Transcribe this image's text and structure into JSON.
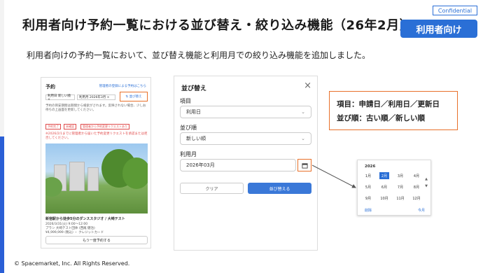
{
  "slide": {
    "title": "利用者向け予約一覧における並び替え・絞り込み機能（26年2月）",
    "confidential_label": "Confidential",
    "badge_label": "利用者向け",
    "subtitle": "利用者向けの予約一覧において、並び替え機能と利用月での絞り込み機能を追加しました。",
    "footer": "© Spacemarket, Inc. All Rights Reserved."
  },
  "phone": {
    "title": "予約",
    "link": "管理者の登録による予約はこちら",
    "chip_period": "利用日 新しい順 ×",
    "chip_month": "利用月 2026年3月 ×",
    "sort_button": "⇅ 並び替え",
    "note": "予約の目安期間は期間から検索がされます。反映されない場合、少しお待ちの上画面を更新してください。",
    "tags": [
      "予約完了",
      "未確認",
      "管理者から予約変更リクエストあり"
    ],
    "warning": "※2026/2/1までに管理者から届いた予約変更リクエストを承認または拒否してください。",
    "listing_name": "新宿駅から徒歩5分のダンススタジオ / 大崎テスト",
    "listing_date": "2026/3/31(火) 9:00〜12:00",
    "listing_plan": "プラン 大崎テスト団体 (西尾 健治)",
    "listing_price": "¥4,999,999 (税込) ・ クレジットカード",
    "rebook_button": "もう一度予約する"
  },
  "dialog": {
    "title": "並び替え",
    "close_icon": "×",
    "item_label": "項目",
    "item_value": "利用日",
    "order_label": "並び順",
    "order_value": "新しい順",
    "month_label": "利用月",
    "month_value": "2026年03月",
    "clear_button": "クリア",
    "apply_button": "並び替える"
  },
  "info": {
    "row1": "項目：申請日／利用日／更新日",
    "row2": "並び順：古い順／新しい順"
  },
  "picker": {
    "year": "2026",
    "months": [
      "1月",
      "2月",
      "3月",
      "4月",
      "5月",
      "6月",
      "7月",
      "8月",
      "9月",
      "10月",
      "11月",
      "12月"
    ],
    "selected": "2月",
    "delete_label": "削除",
    "this_month_label": "今月",
    "up_arrow": "▲",
    "down_arrow": "▼"
  },
  "colors": {
    "brand_blue": "#2a6fd6",
    "highlight_orange": "#e8702a",
    "warning_red": "#e04c4c"
  }
}
